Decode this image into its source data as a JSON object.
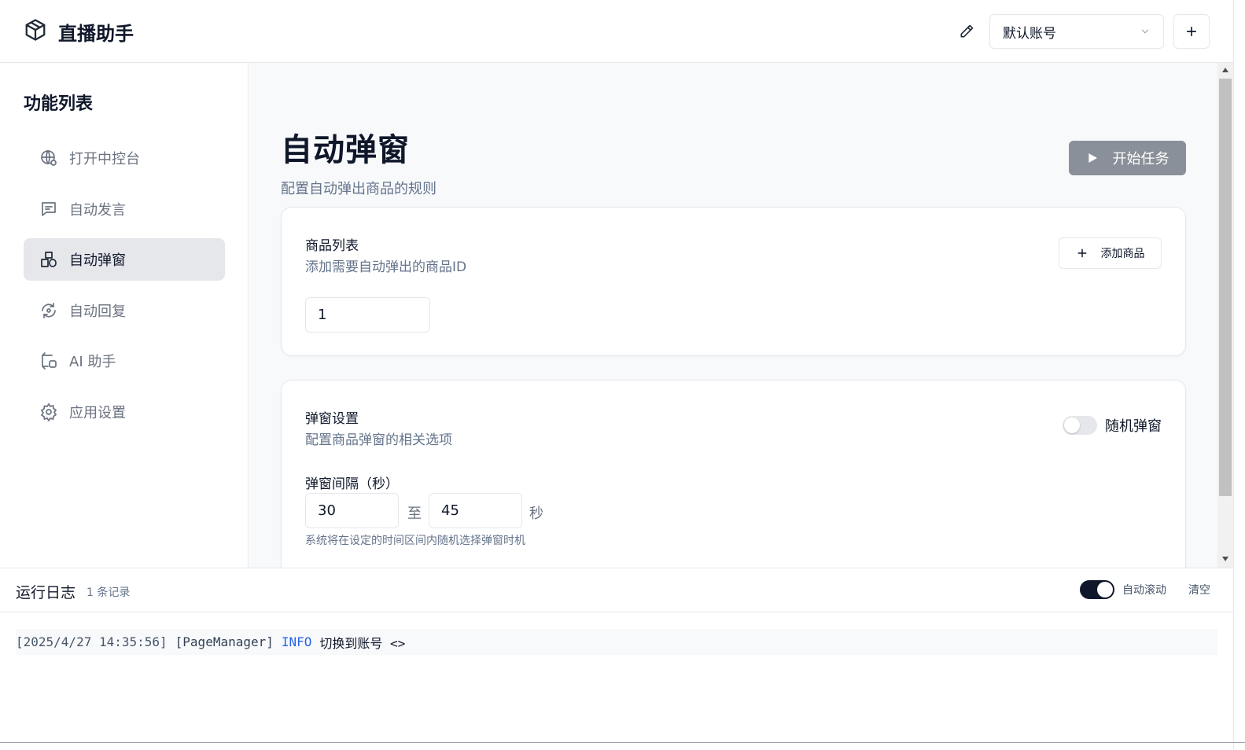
{
  "app": {
    "title": "直播助手"
  },
  "header": {
    "account_selected": "默认账号"
  },
  "sidebar": {
    "title": "功能列表",
    "items": [
      {
        "label": "打开中控台",
        "icon": "globe-icon"
      },
      {
        "label": "自动发言",
        "icon": "message-icon"
      },
      {
        "label": "自动弹窗",
        "icon": "package-popup-icon",
        "active": true
      },
      {
        "label": "自动回复",
        "icon": "sync-reply-icon"
      },
      {
        "label": "AI 助手",
        "icon": "ai-assistant-icon"
      },
      {
        "label": "应用设置",
        "icon": "gear-icon"
      }
    ]
  },
  "page": {
    "title": "自动弹窗",
    "subtitle": "配置自动弹出商品的规则",
    "start_button": "开始任务"
  },
  "products_card": {
    "title": "商品列表",
    "description": "添加需要自动弹出的商品ID",
    "add_button": "添加商品",
    "product_ids": [
      "1"
    ]
  },
  "popup_card": {
    "title": "弹窗设置",
    "description": "配置商品弹窗的相关选项",
    "random_toggle_label": "随机弹窗",
    "random_enabled": false,
    "interval_label": "弹窗间隔（秒）",
    "interval_min": "30",
    "interval_to": "至",
    "interval_max": "45",
    "interval_unit": "秒",
    "interval_hint": "系统将在设定的时间区间内随机选择弹窗时机"
  },
  "log": {
    "title": "运行日志",
    "count": "1 条记录",
    "autoscroll_label": "自动滚动",
    "autoscroll_enabled": true,
    "clear_label": "清空",
    "entries": [
      {
        "timestamp": "[2025/4/27 14:35:56]",
        "source": "[PageManager]",
        "level": "INFO",
        "message": "切换到账号 <>"
      }
    ]
  },
  "colors": {
    "accent": "#0f172a",
    "muted": "#64748b",
    "start_button_bg": "#8a9099",
    "info": "#2563eb"
  }
}
